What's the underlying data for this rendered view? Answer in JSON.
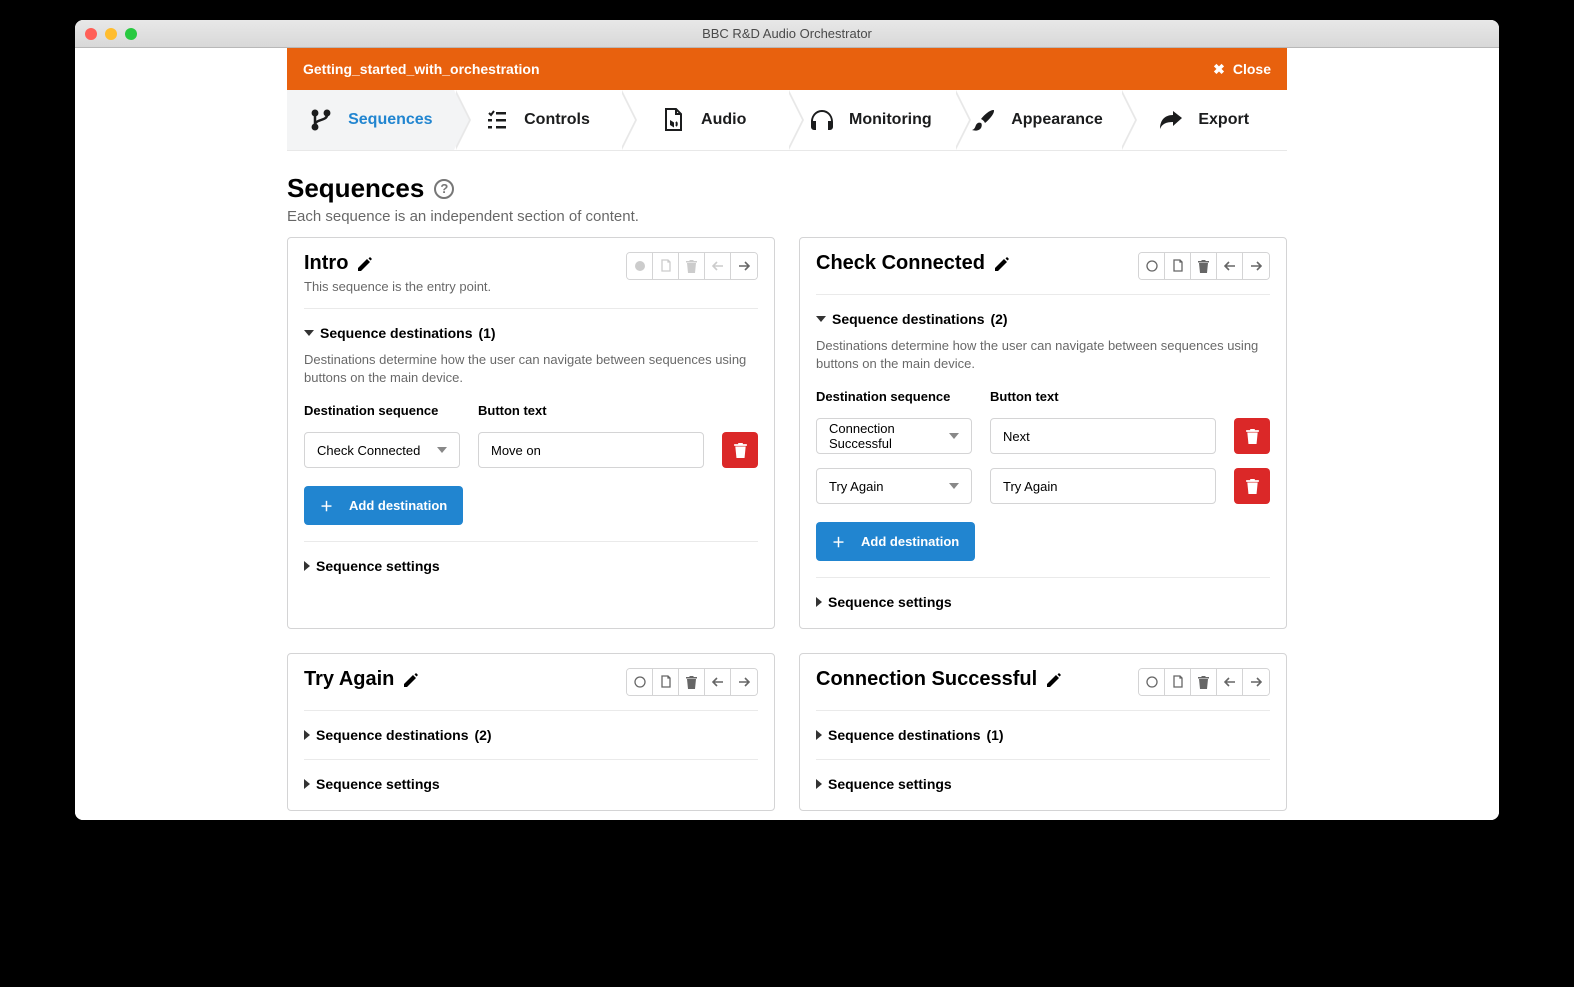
{
  "window": {
    "title": "BBC R&D Audio Orchestrator"
  },
  "topbar": {
    "project": "Getting_started_with_orchestration",
    "close": "Close"
  },
  "tabs": {
    "sequences": "Sequences",
    "controls": "Controls",
    "audio": "Audio",
    "monitoring": "Monitoring",
    "appearance": "Appearance",
    "export": "Export"
  },
  "page": {
    "title": "Sequences",
    "subtitle": "Each sequence is an independent section of content."
  },
  "labels": {
    "dest_sequence": "Destination sequence",
    "button_text": "Button text",
    "add_destination": "Add destination",
    "seq_destinations": "Sequence destinations",
    "seq_settings": "Sequence settings",
    "dest_desc": "Destinations determine how the user can navigate between sequences using buttons on the main device."
  },
  "cards": {
    "intro": {
      "title": "Intro",
      "sub": "This sequence is the entry point.",
      "dest_count": "(1)",
      "rows": [
        {
          "seq": "Check Connected",
          "btn": "Move on"
        }
      ]
    },
    "check": {
      "title": "Check Connected",
      "dest_count": "(2)",
      "rows": [
        {
          "seq": "Connection Successful",
          "btn": "Next"
        },
        {
          "seq": "Try Again",
          "btn": "Try Again"
        }
      ]
    },
    "tryagain": {
      "title": "Try Again",
      "dest_count": "(2)"
    },
    "conn": {
      "title": "Connection Successful",
      "dest_count": "(1)"
    }
  }
}
